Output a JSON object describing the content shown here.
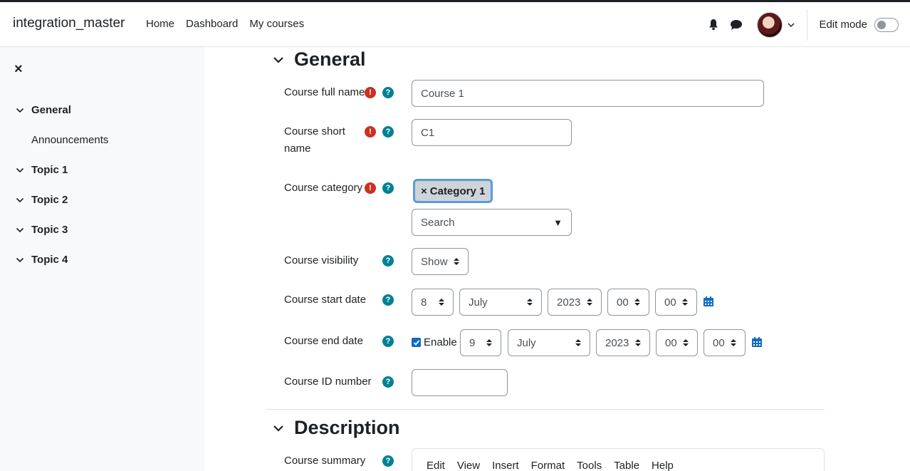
{
  "navbar": {
    "site_name": "integration_master",
    "links": [
      "Home",
      "Dashboard",
      "My courses"
    ],
    "edit_mode_label": "Edit mode"
  },
  "drawer": {
    "close_symbol": "×",
    "items": [
      {
        "label": "General",
        "kind": "section"
      },
      {
        "label": "Announcements",
        "kind": "activity"
      },
      {
        "label": "Topic 1",
        "kind": "section"
      },
      {
        "label": "Topic 2",
        "kind": "section"
      },
      {
        "label": "Topic 3",
        "kind": "section"
      },
      {
        "label": "Topic 4",
        "kind": "section"
      }
    ]
  },
  "form": {
    "general_heading": "General",
    "full_name": {
      "label": "Course full name",
      "value": "Course 1"
    },
    "short_name": {
      "label": "Course short name",
      "value": "C1"
    },
    "category": {
      "label": "Course category",
      "selected": "Category 1",
      "remove_symbol": "×",
      "search_placeholder": "Search",
      "dropdown_symbol": "▼"
    },
    "visibility": {
      "label": "Course visibility",
      "value": "Show"
    },
    "start_date": {
      "label": "Course start date",
      "day": "8",
      "month": "July",
      "year": "2023",
      "hour": "00",
      "minute": "00"
    },
    "end_date": {
      "label": "Course end date",
      "enable_label": "Enable",
      "enabled": true,
      "day": "9",
      "month": "July",
      "year": "2023",
      "hour": "00",
      "minute": "00"
    },
    "id_number": {
      "label": "Course ID number",
      "value": ""
    },
    "description_heading": "Description",
    "summary": {
      "label": "Course summary",
      "editor_menu": [
        "Edit",
        "View",
        "Insert",
        "Format",
        "Tools",
        "Table",
        "Help"
      ]
    }
  },
  "colors": {
    "required": "#ca3120",
    "help": "#008196",
    "primary": "#0f6cbf",
    "badge_bg": "#ced4da",
    "drawer_bg": "#f8f9fa"
  }
}
